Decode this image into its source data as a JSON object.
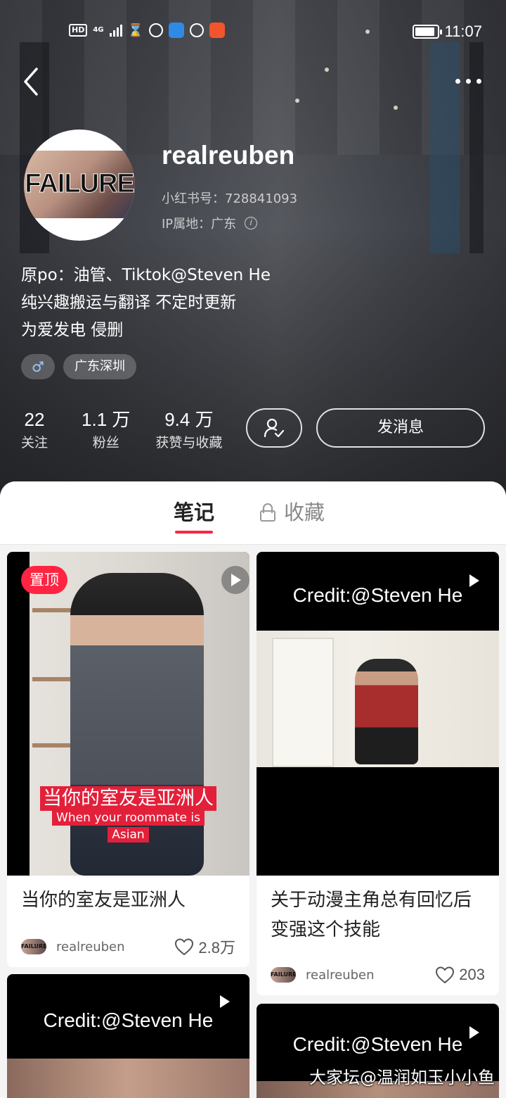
{
  "status_bar": {
    "hd": "HD",
    "network": "4G",
    "battery_level": 0.8,
    "time": "11:07"
  },
  "profile": {
    "username": "realreuben",
    "avatar_text": "FAILURE",
    "id_line": "小红书号：728841093",
    "ip_line": "IP属地：广东",
    "bio": [
      "原po：油管、Tiktok@Steven He",
      "纯兴趣搬运与翻译 不定时更新",
      "为爱发电 侵删"
    ],
    "tags": {
      "gender": "♂",
      "location": "广东深圳"
    },
    "stats": [
      {
        "num": "22",
        "label": "关注"
      },
      {
        "num": "1.1 万",
        "label": "粉丝"
      },
      {
        "num": "9.4 万",
        "label": "获赞与收藏"
      }
    ],
    "message_button": "发消息"
  },
  "tabs": {
    "notes": "笔记",
    "collect": "收藏"
  },
  "posts": [
    {
      "pin": "置顶",
      "subtitle_zh": "当你的室友是亚洲人",
      "subtitle_en_1": "When your roommate is",
      "subtitle_en_2": "Asian",
      "title": "当你的室友是亚洲人",
      "author": "realreuben",
      "likes": "2.8万"
    },
    {
      "credit": "Credit:@Steven He",
      "title": "关于动漫主角总有回忆后变强这个技能",
      "author": "realreuben",
      "likes": "203"
    },
    {
      "credit": "Credit:@Steven He"
    },
    {
      "credit": "Credit:@Steven He"
    }
  ],
  "watermark": "大家坛@温润如玉小小鱼",
  "colors": {
    "accent": "#ff2442",
    "subtitle_red": "#e3203a"
  }
}
